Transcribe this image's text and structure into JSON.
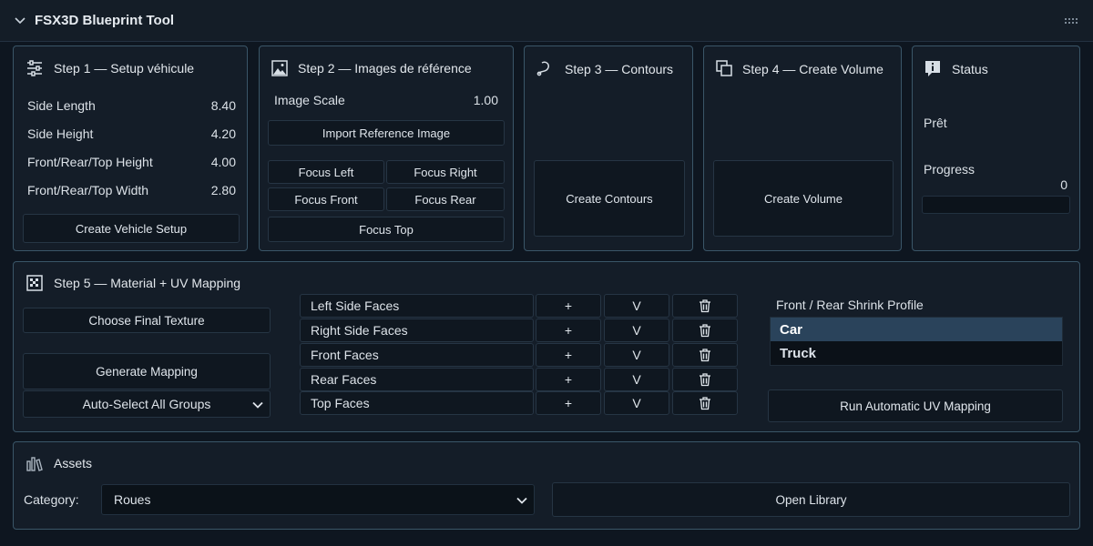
{
  "app": {
    "title": "FSX3D Blueprint Tool"
  },
  "step1": {
    "title": "Step 1 — Setup véhicule",
    "fields": [
      {
        "label": "Side Length",
        "value": "8.40"
      },
      {
        "label": "Side Height",
        "value": "4.20"
      },
      {
        "label": "Front/Rear/Top Height",
        "value": "4.00"
      },
      {
        "label": "Front/Rear/Top Width",
        "value": "2.80"
      }
    ],
    "create_button": "Create Vehicle Setup"
  },
  "step2": {
    "title": "Step 2 — Images de référence",
    "scale_label": "Image Scale",
    "scale_value": "1.00",
    "import_button": "Import Reference Image",
    "focus_left": "Focus Left",
    "focus_right": "Focus Right",
    "focus_front": "Focus Front",
    "focus_rear": "Focus Rear",
    "focus_top": "Focus Top"
  },
  "step3": {
    "title": "Step 3 — Contours",
    "button": "Create Contours"
  },
  "step4": {
    "title": "Step 4 — Create Volume",
    "button": "Create Volume"
  },
  "status": {
    "title": "Status",
    "state": "Prêt",
    "progress_label": "Progress",
    "progress_value": "0",
    "progress_fraction": 0
  },
  "step5": {
    "title": "Step 5 — Material + UV Mapping",
    "choose_texture": "Choose Final Texture",
    "generate_mapping": "Generate Mapping",
    "auto_select": "Auto-Select All Groups",
    "groups": [
      {
        "label": "Left Side Faces",
        "add": "+",
        "select": "V"
      },
      {
        "label": "Right Side Faces",
        "add": "+",
        "select": "V"
      },
      {
        "label": "Front Faces",
        "add": "+",
        "select": "V"
      },
      {
        "label": "Rear Faces",
        "add": "+",
        "select": "V"
      },
      {
        "label": "Top Faces",
        "add": "+",
        "select": "V"
      }
    ],
    "shrink_label": "Front / Rear Shrink Profile",
    "shrink_options": [
      "Car",
      "Truck"
    ],
    "shrink_selected": "Car",
    "run_button": "Run Automatic UV Mapping"
  },
  "assets": {
    "title": "Assets",
    "category_label": "Category:",
    "category_value": "Roues",
    "open_library": "Open Library"
  },
  "colors": {
    "background": "#0e1620",
    "panel": "#141d28",
    "border": "#3a5668",
    "selection": "#2a435b"
  }
}
